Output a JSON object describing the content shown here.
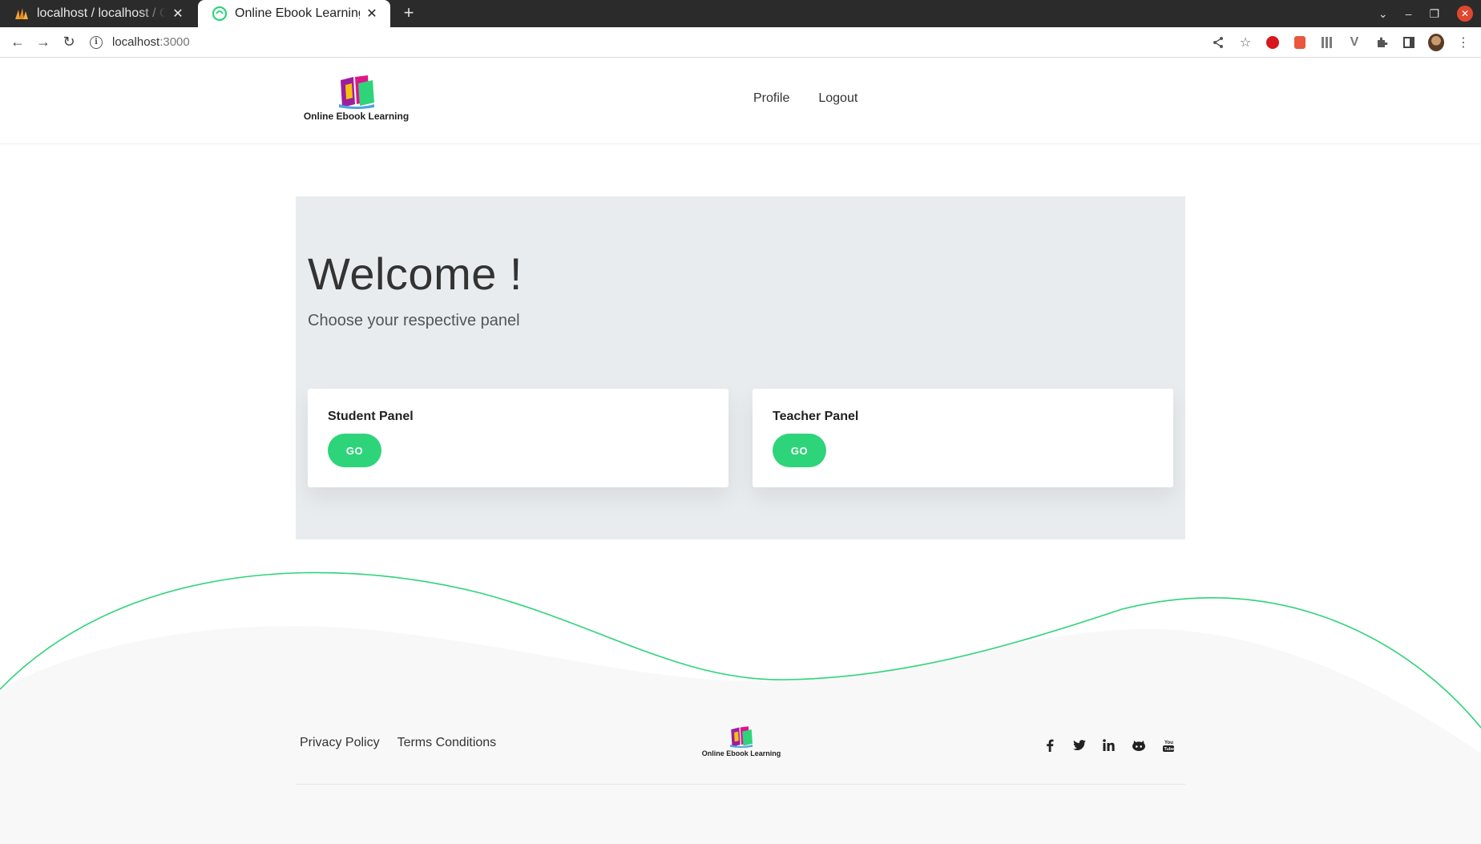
{
  "browser": {
    "tabs": [
      {
        "title": "localhost / localhost / Online Ebook Learning",
        "active": false
      },
      {
        "title": "Online Ebook Learning",
        "active": true
      }
    ],
    "new_tab_label": "+",
    "url_host": "localhost",
    "url_port": ":3000"
  },
  "header": {
    "logo_text": "Online Ebook Learning",
    "nav": {
      "profile": "Profile",
      "logout": "Logout"
    }
  },
  "hero": {
    "title": "Welcome !",
    "subtitle": "Choose your respective panel",
    "panels": [
      {
        "title": "Student Panel",
        "button": "GO"
      },
      {
        "title": "Teacher Panel",
        "button": "GO"
      }
    ]
  },
  "footer": {
    "links": {
      "privacy": "Privacy Policy",
      "terms": "Terms Conditions"
    },
    "logo_text": "Online Ebook Learning",
    "social_icons": [
      "facebook-icon",
      "twitter-icon",
      "linkedin-icon",
      "github-icon",
      "youtube-icon"
    ]
  },
  "colors": {
    "accent": "#2ed47a",
    "hero_bg": "#e9ecef",
    "tabbar_bg": "#2b2b2b",
    "footer_bg": "#f8f8f8"
  }
}
